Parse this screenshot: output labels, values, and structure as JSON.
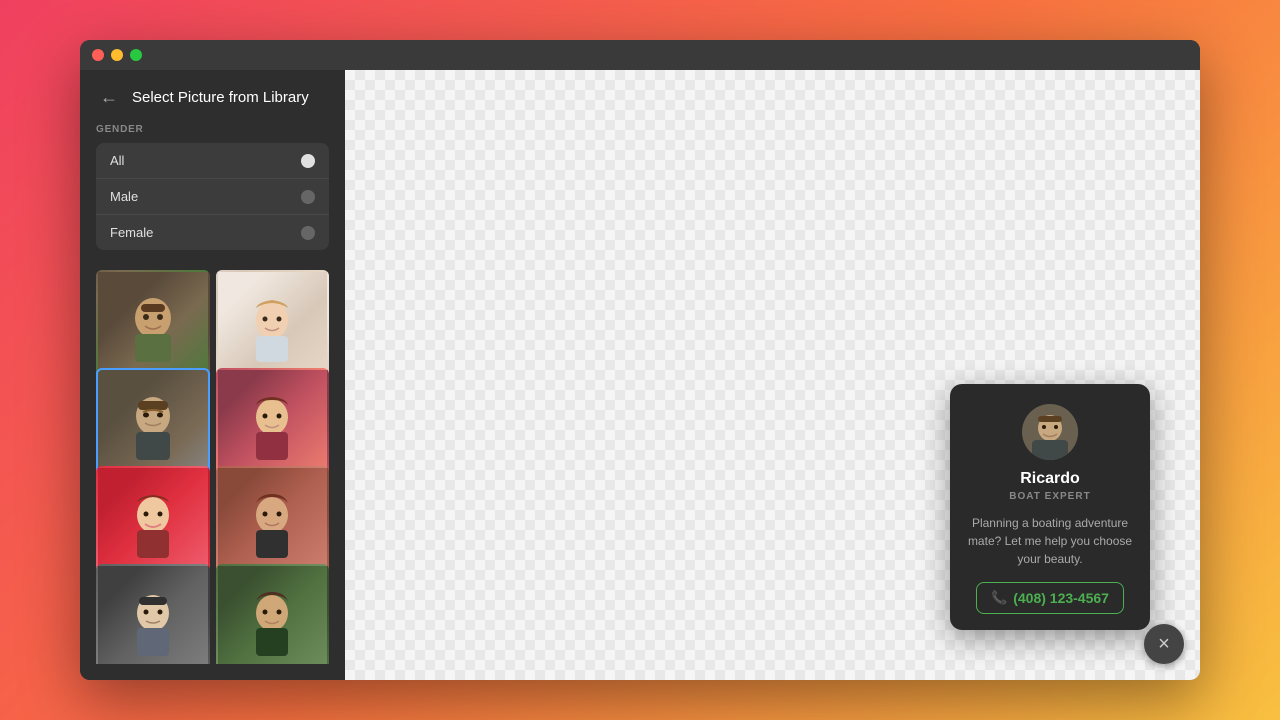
{
  "window": {
    "titlebar": {
      "dot1": "red",
      "dot2": "yellow",
      "dot3": "green"
    }
  },
  "sidebar": {
    "title": "Select Picture from Library",
    "back_label": "←",
    "filter": {
      "label": "GENDER",
      "options": [
        {
          "id": "all",
          "label": "All",
          "selected": true
        },
        {
          "id": "male",
          "label": "Male",
          "selected": false
        },
        {
          "id": "female",
          "label": "Female",
          "selected": false
        }
      ]
    },
    "photos": [
      {
        "id": "p1",
        "class": "p1",
        "selected": false,
        "emoji": "👨"
      },
      {
        "id": "p2",
        "class": "p2",
        "selected": false,
        "emoji": "👩"
      },
      {
        "id": "p3",
        "class": "p3",
        "selected": true,
        "emoji": "👨"
      },
      {
        "id": "p4",
        "class": "p4",
        "selected": false,
        "emoji": "👩"
      },
      {
        "id": "p5",
        "class": "p5",
        "selected": false,
        "emoji": "👩"
      },
      {
        "id": "p6",
        "class": "p6",
        "selected": false,
        "emoji": "👩"
      },
      {
        "id": "p7",
        "class": "p7",
        "selected": false,
        "emoji": "👦"
      },
      {
        "id": "p8",
        "class": "p8",
        "selected": false,
        "emoji": "👧"
      }
    ]
  },
  "contact_card": {
    "name": "Ricardo",
    "role": "BOAT EXPERT",
    "bio": "Planning a boating adventure mate? Let me help you choose your beauty.",
    "phone": "(408) 123-4567",
    "phone_icon": "📞"
  },
  "close_button_label": "×"
}
